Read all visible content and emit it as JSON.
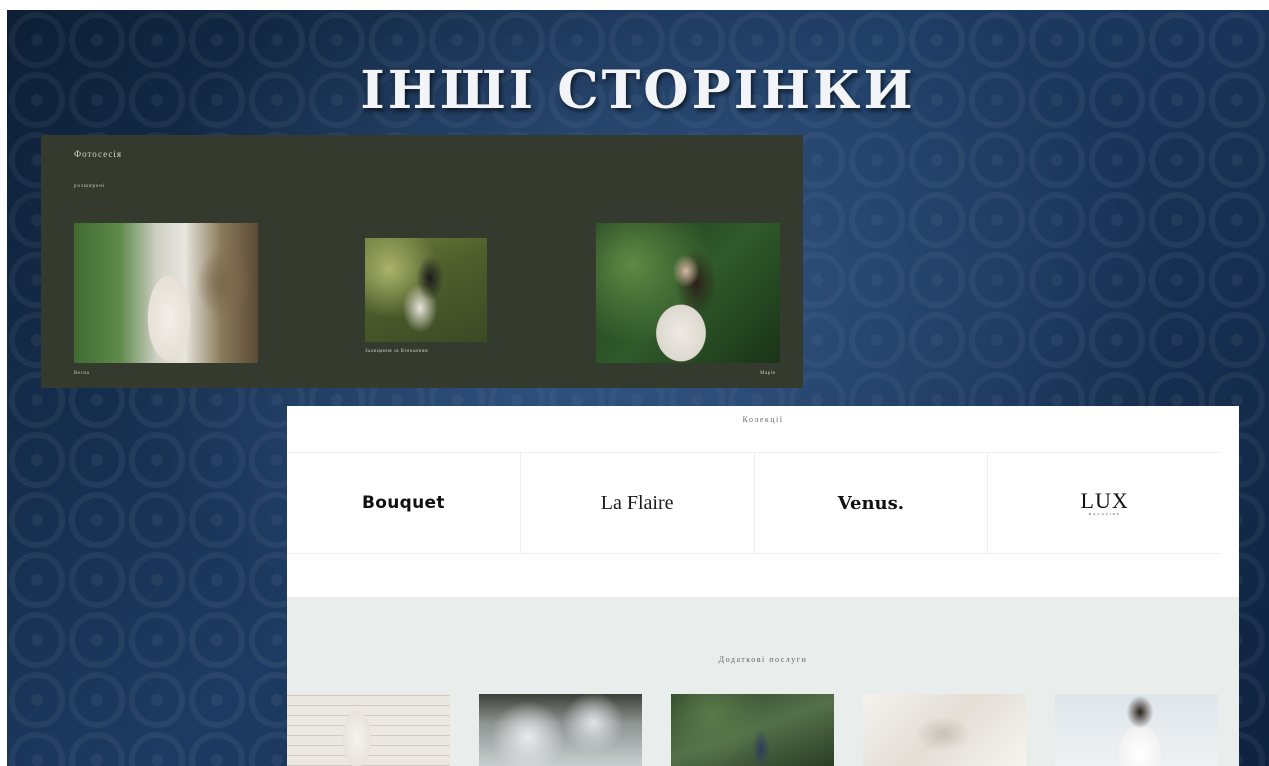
{
  "slide": {
    "title": "ІНШІ СТОРІНКИ"
  },
  "gallery_page": {
    "brand": "Фотосесія",
    "subtitle": "розширені",
    "photos": [
      {
        "caption": "Весна"
      },
      {
        "caption": "Залицяння за Вінчанням"
      },
      {
        "caption": "Марія"
      }
    ]
  },
  "collections_page": {
    "heading": "Колекції",
    "logos": [
      {
        "text": "Bouquet"
      },
      {
        "text": "La Flaire"
      },
      {
        "text": "Venus."
      },
      {
        "text": "LUX",
        "sub": "MAGAZINE"
      }
    ],
    "services_heading": "Додаткові послуги",
    "service_count_label": ""
  },
  "colors": {
    "slide_bg": "#1d3b62",
    "gallery_bg": "#353a2f",
    "services_bg": "#e9eeec"
  }
}
